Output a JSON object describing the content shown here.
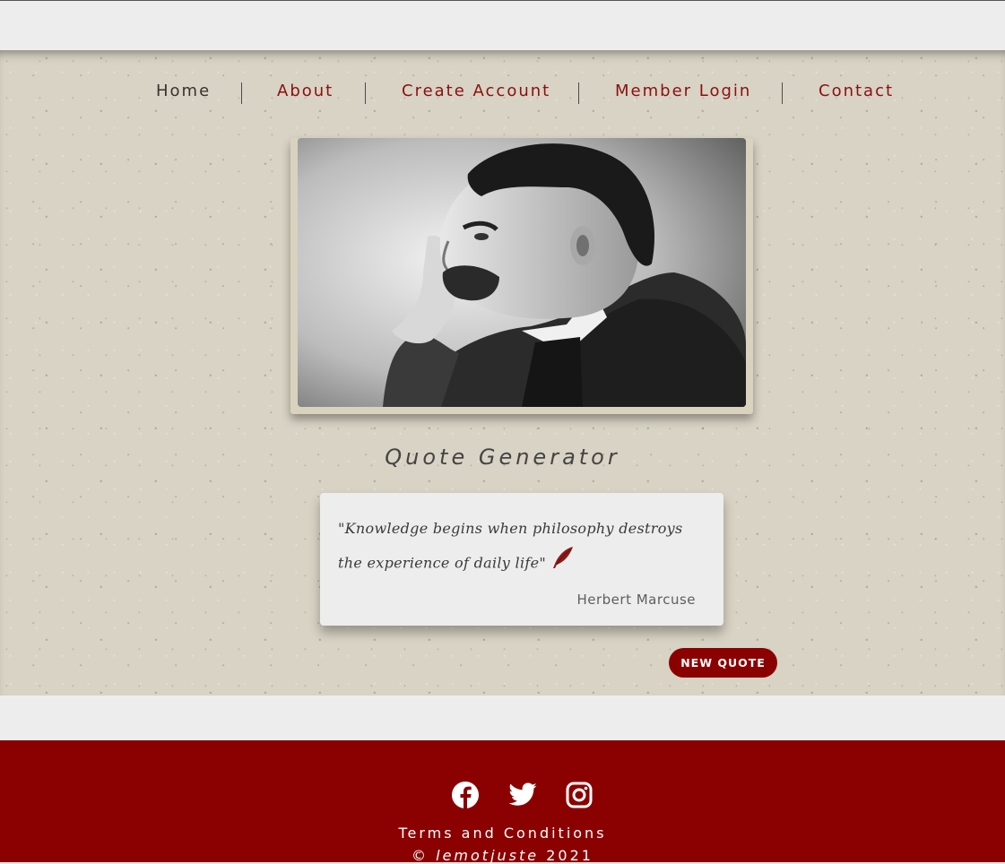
{
  "nav": {
    "items": [
      {
        "label": "Home",
        "active": true
      },
      {
        "label": "About",
        "active": false
      },
      {
        "label": "Create Account",
        "active": false
      },
      {
        "label": "Member Login",
        "active": false
      },
      {
        "label": "Contact",
        "active": false
      }
    ]
  },
  "main": {
    "title": "Quote Generator",
    "quote": {
      "text": "\"Knowledge begins when philosophy destroys the experience of daily life\"",
      "author": "Herbert Marcuse",
      "icon": "quill-icon"
    },
    "new_quote_label": "NEW QUOTE"
  },
  "footer": {
    "social_icons": [
      "facebook-icon",
      "twitter-icon",
      "instagram-icon"
    ],
    "terms_label": "Terms and Conditions",
    "copyright_symbol": "©",
    "brand": "lemotjuste",
    "year": "2021"
  },
  "colors": {
    "accent": "#8b0000",
    "nav_link": "#8b0f0f",
    "paper": "#d8d3c4",
    "background": "#ededed"
  }
}
